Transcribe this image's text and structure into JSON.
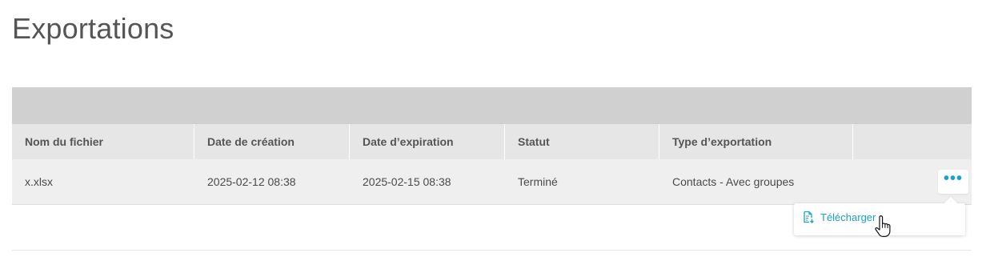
{
  "page": {
    "title": "Exportations"
  },
  "table": {
    "columns": [
      "Nom du fichier",
      "Date de création",
      "Date d’expiration",
      "Statut",
      "Type d’exportation",
      ""
    ],
    "rows": [
      {
        "file_name": "x.xlsx",
        "created": "2025-02-12 08:38",
        "expires": "2025-02-15 08:38",
        "status": "Terminé",
        "export_type": "Contacts - Avec groupes",
        "actions_icon": "more-horizontal-icon"
      }
    ]
  },
  "actions_menu": {
    "items": [
      {
        "label": "Télécharger",
        "icon": "download-file-icon"
      }
    ]
  },
  "colors": {
    "accent": "#1aa3c4",
    "toolbar_band": "#d0d0d0",
    "header_bg": "#e6e6e6",
    "row_bg": "#efefef",
    "text": "#4a4a4a"
  }
}
